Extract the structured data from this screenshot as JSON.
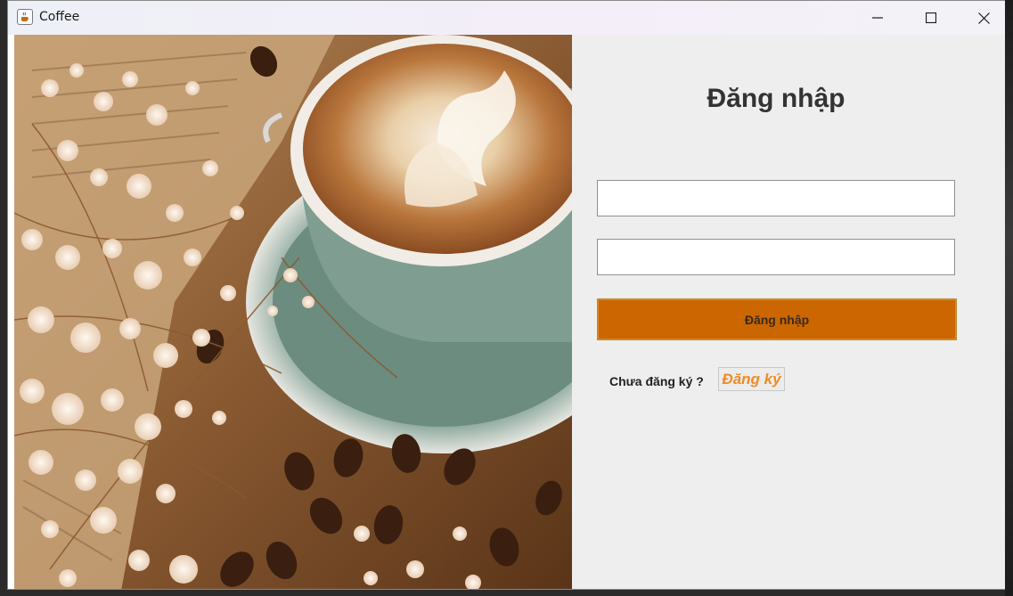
{
  "window": {
    "title": "Coffee",
    "icon": "java-cup-icon"
  },
  "window_controls": {
    "minimize_icon": "minimize-icon",
    "maximize_icon": "maximize-icon",
    "close_icon": "close-icon"
  },
  "photo": {
    "subject": "latte-art-coffee-cup-photo"
  },
  "login_form": {
    "heading": "Đăng nhập",
    "username_value": "",
    "password_value": "",
    "submit_label": "Đăng nhập",
    "register_prompt": "Chưa đăng ký ?",
    "register_link": "Đăng ký"
  },
  "colors": {
    "accent_button": "#cc6600",
    "register_link": "#f08a24",
    "panel_background": "#eeeeee"
  }
}
